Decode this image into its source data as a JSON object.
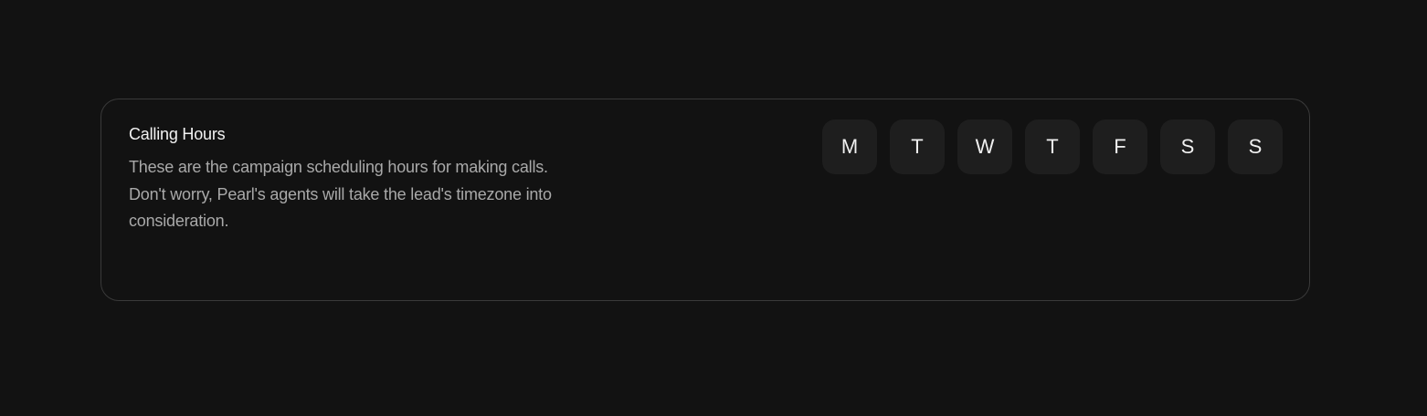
{
  "calling_hours": {
    "title": "Calling Hours",
    "description_line_1": "These are the campaign scheduling hours for making calls.",
    "description_line_2": "Don't worry, Pearl's agents will take the lead's timezone into consideration.",
    "days": [
      {
        "label": "M"
      },
      {
        "label": "T"
      },
      {
        "label": "W"
      },
      {
        "label": "T"
      },
      {
        "label": "F"
      },
      {
        "label": "S"
      },
      {
        "label": "S"
      }
    ]
  }
}
